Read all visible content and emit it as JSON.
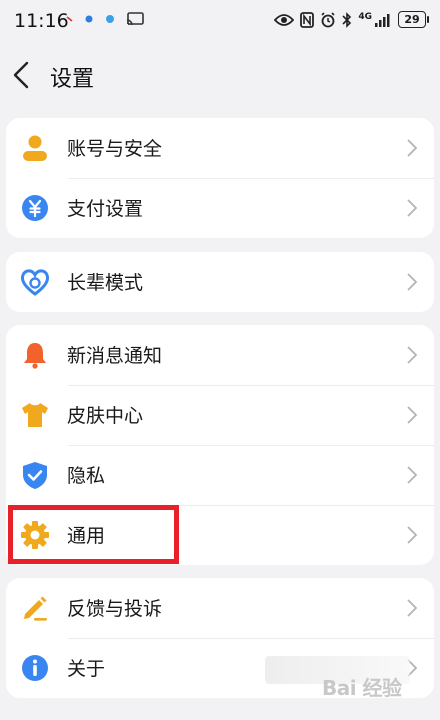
{
  "status_bar": {
    "time": "11:16",
    "battery": "29",
    "network": "4G"
  },
  "header": {
    "title": "设置"
  },
  "groups": [
    {
      "items": [
        {
          "label": "账号与安全",
          "icon": "person-icon",
          "color": "#f0a81c"
        },
        {
          "label": "支付设置",
          "icon": "yen-icon",
          "color": "#3a86f0"
        }
      ]
    },
    {
      "items": [
        {
          "label": "长辈模式",
          "icon": "heart-icon",
          "color": "#3a86f0"
        }
      ]
    },
    {
      "items": [
        {
          "label": "新消息通知",
          "icon": "bell-icon",
          "color": "#f2622a"
        },
        {
          "label": "皮肤中心",
          "icon": "shirt-icon",
          "color": "#f0a81c"
        },
        {
          "label": "隐私",
          "icon": "shield-icon",
          "color": "#3a86f0"
        },
        {
          "label": "通用",
          "icon": "gear-icon",
          "color": "#f0a81c"
        }
      ]
    },
    {
      "items": [
        {
          "label": "反馈与投诉",
          "icon": "pencil-icon",
          "color": "#f0a81c"
        },
        {
          "label": "关于",
          "icon": "info-icon",
          "color": "#3a86f0"
        }
      ]
    }
  ],
  "annotation": {
    "highlight_color": "#e8202a"
  },
  "watermark": "Bai 经验"
}
